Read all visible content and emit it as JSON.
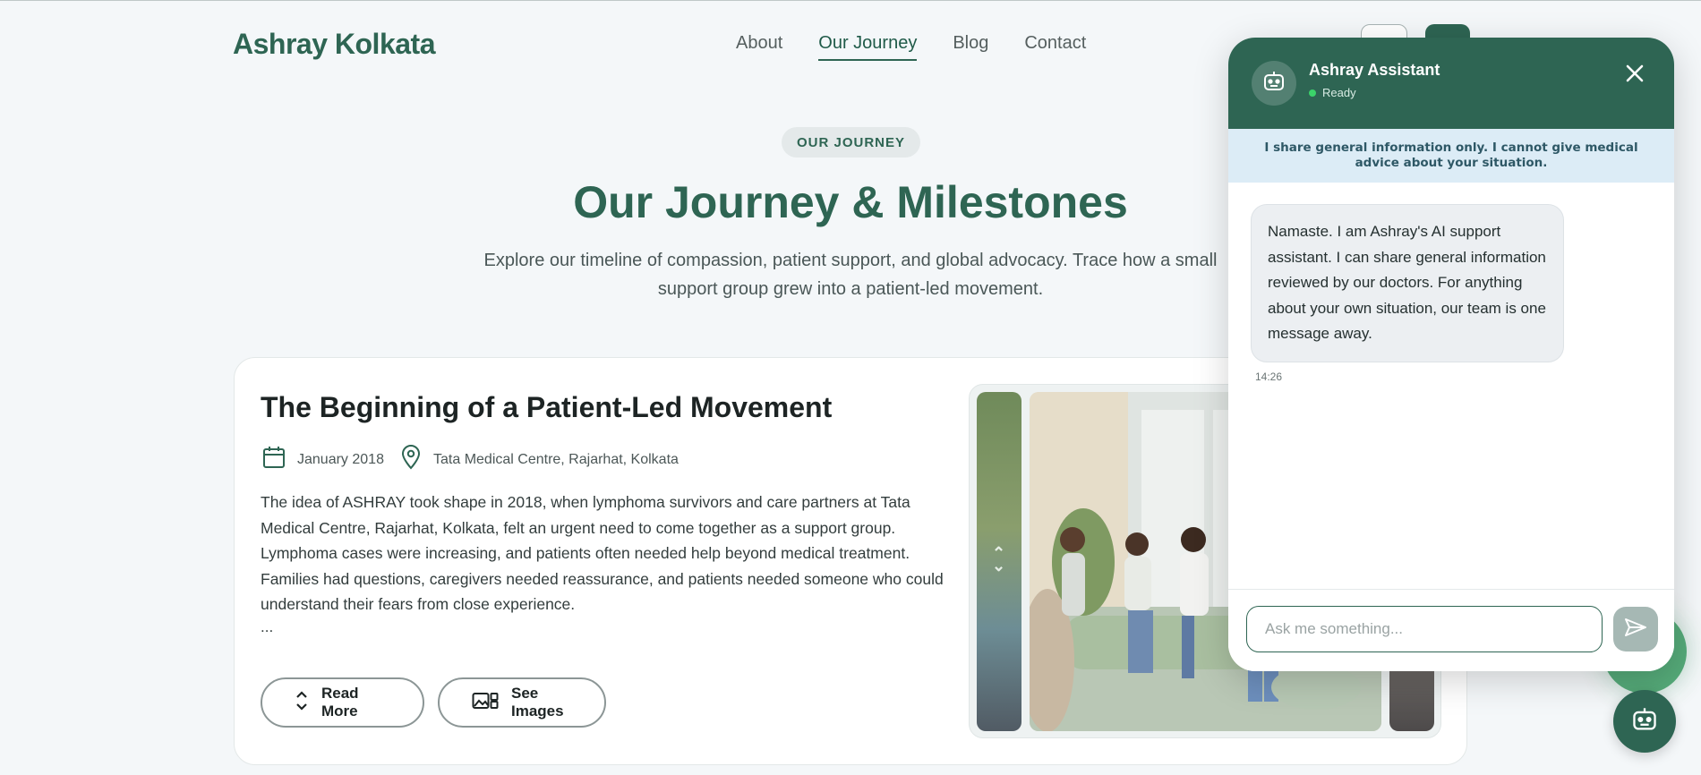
{
  "header": {
    "logo": "Ashray Kolkata",
    "nav": [
      {
        "label": "About"
      },
      {
        "label": "Our Journey"
      },
      {
        "label": "Blog"
      },
      {
        "label": "Contact"
      }
    ]
  },
  "hero": {
    "pill": "OUR JOURNEY",
    "title": "Our Journey & Milestones",
    "subtitle": "Explore our timeline of compassion, patient support, and global advocacy. Trace how a small support group grew into a patient-led movement."
  },
  "milestone": {
    "title": "The Beginning of a Patient-Led Movement",
    "date": "January 2018",
    "location": "Tata Medical Centre, Rajarhat, Kolkata",
    "body": "The idea of ASHRAY took shape in 2018, when lymphoma survivors and care partners at Tata Medical Centre, Rajarhat, Kolkata, felt an urgent need to come together as a support group. Lymphoma cases were increasing, and patients often needed help beyond medical treatment. Families had questions, caregivers needed reassurance, and patients needed someone who could understand their fears from close experience.",
    "ellipsis": "...",
    "read_more": "Read More",
    "see_images": "See Images"
  },
  "chat": {
    "name": "Ashray Assistant",
    "status": "Ready",
    "disclaimer": "I share general information only. I cannot give medical advice about your situation.",
    "message": "Namaste. I am Ashray's AI support assistant. I can share general information reviewed by our doctors. For anything about your own situation, our team is one message away.",
    "time": "14:26",
    "input_placeholder": "Ask me something..."
  },
  "colors": {
    "brand": "#2e6553",
    "status_ready": "#3bd36a",
    "disclaimer_bg": "#dcecf6"
  }
}
